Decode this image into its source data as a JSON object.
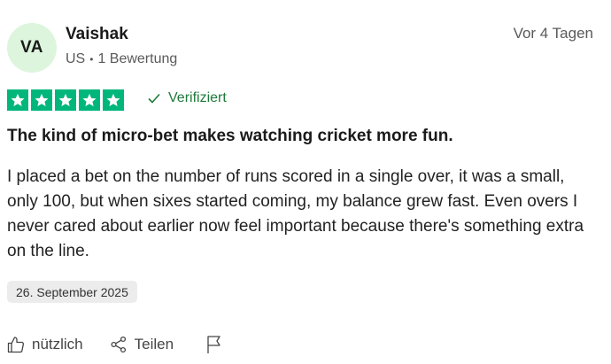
{
  "reviewer": {
    "initials": "VA",
    "name": "Vaishak",
    "country": "US",
    "separator": "•",
    "reviews": "1 Bewertung"
  },
  "review": {
    "relative_date": "Vor 4 Tagen",
    "rating": 5,
    "verified_label": "Verifiziert",
    "title": "The kind of micro-bet makes watching cricket more fun.",
    "body": "I placed a bet on the number of runs scored in a single over, it was a small, only 100, but when sixes started coming, my balance grew fast. Even overs I never cared about earlier now feel important because there's something extra on the line.",
    "experience_date": "26. September 2025"
  },
  "actions": {
    "useful_label": "nützlich",
    "share_label": "Teilen",
    "useful_icon": "thumbs-up-icon",
    "share_icon": "share-icon",
    "report_icon": "flag-icon"
  },
  "colors": {
    "star_green": "#00b67a",
    "verified_green": "#1e7a3a",
    "avatar_bg": "#dcf5dc"
  }
}
